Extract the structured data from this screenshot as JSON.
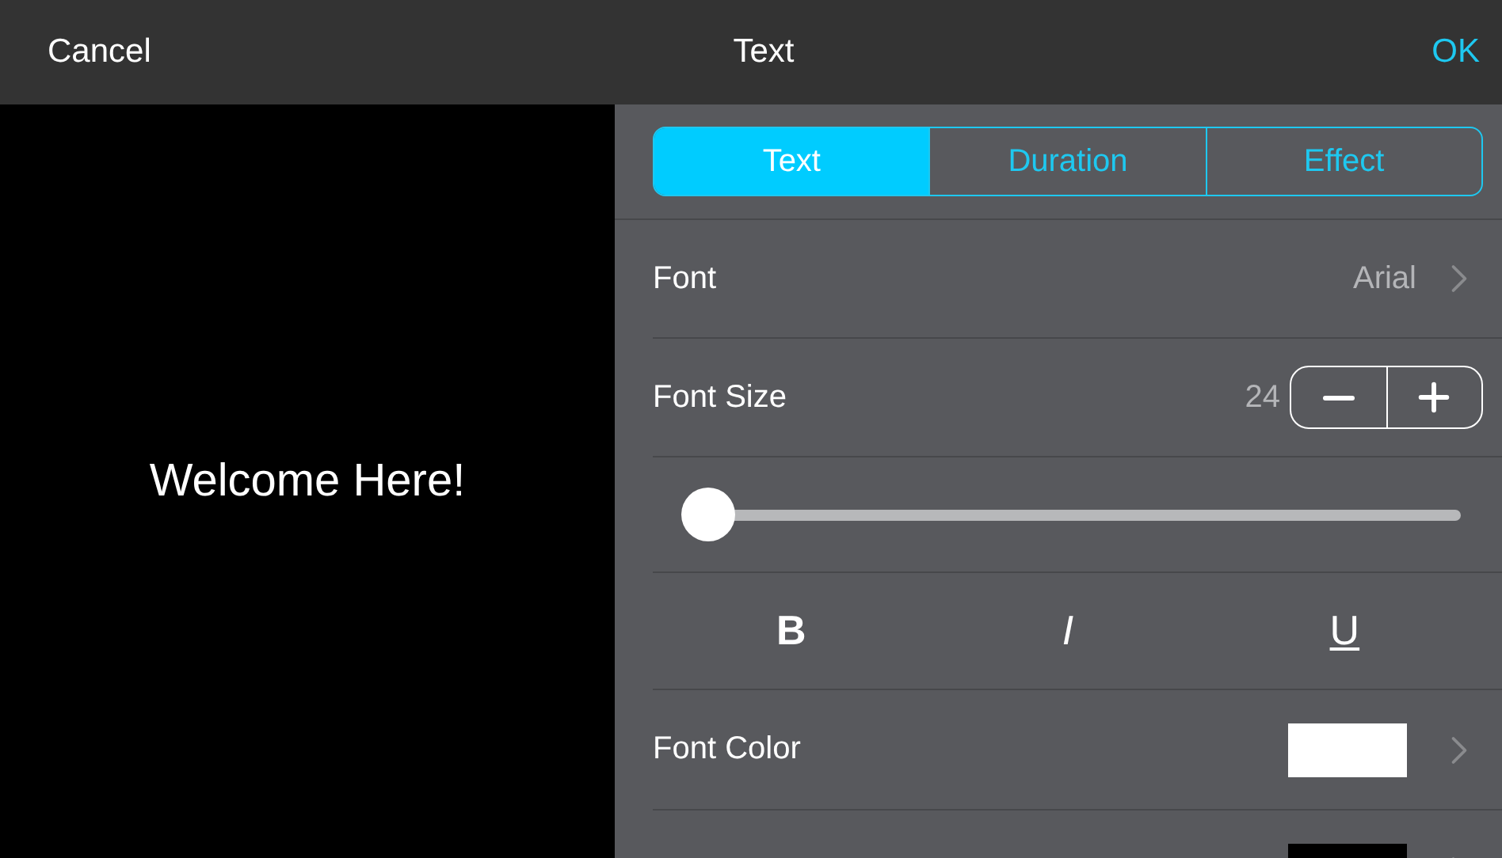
{
  "top_bar": {
    "cancel": "Cancel",
    "title": "Text",
    "ok": "OK"
  },
  "preview": {
    "text": "Welcome Here!"
  },
  "tabs": [
    {
      "label": "Text",
      "selected": true
    },
    {
      "label": "Duration",
      "selected": false
    },
    {
      "label": "Effect",
      "selected": false
    }
  ],
  "rows": [
    {
      "kind": "select",
      "label": "Font",
      "value": "Arial"
    },
    {
      "kind": "stepper",
      "label": "Font Size",
      "value": "24"
    },
    {
      "kind": "slider",
      "level": 0.03
    },
    {
      "kind": "styles",
      "buttons": [
        {
          "label": "B"
        },
        {
          "label": "I"
        },
        {
          "label": "U"
        }
      ]
    },
    {
      "kind": "color",
      "label": "Font Color",
      "color": "#ffffff"
    },
    {
      "kind": "color",
      "color": "#000000"
    }
  ]
}
